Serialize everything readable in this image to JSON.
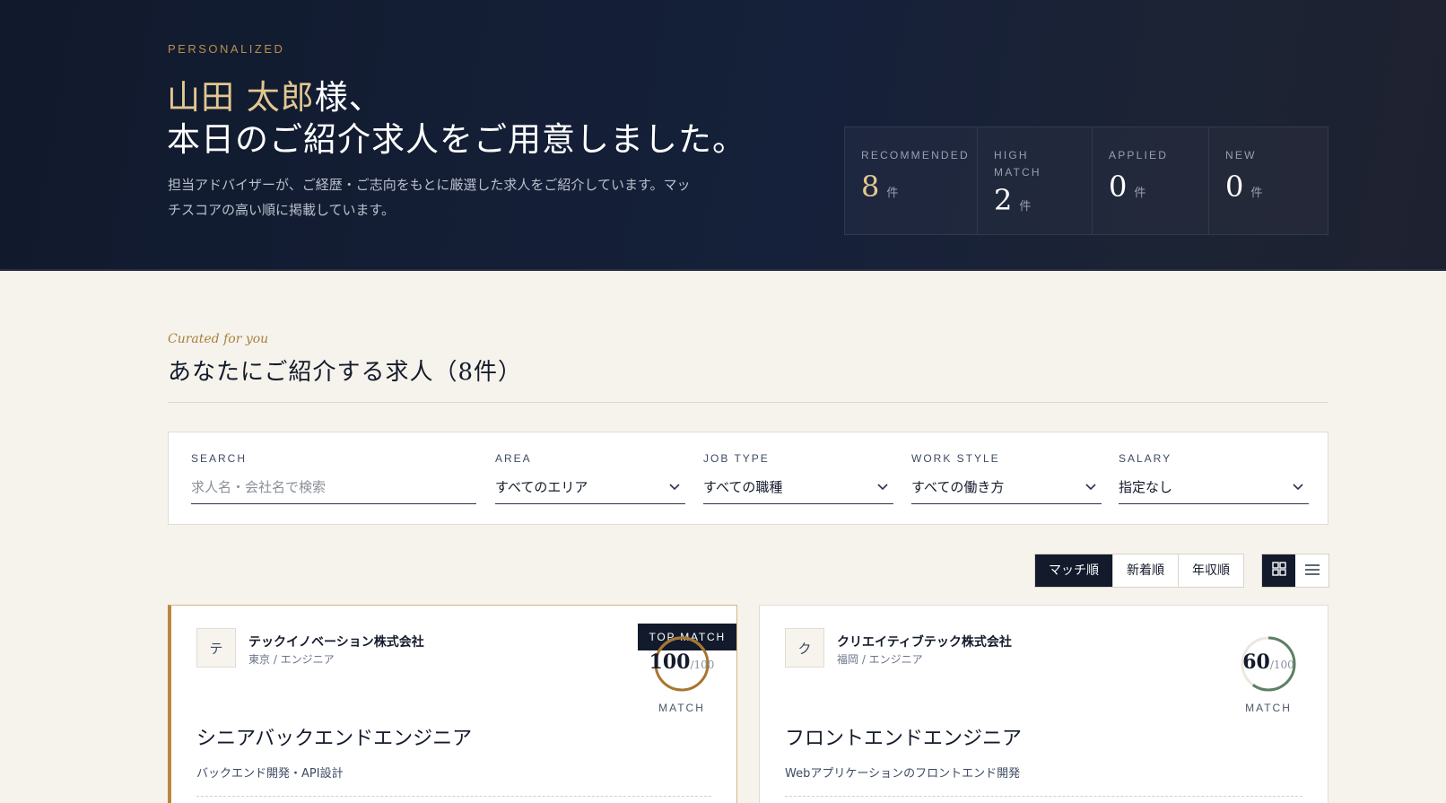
{
  "hero": {
    "eyebrow": "PERSONALIZED",
    "title_name": "山田 太郎",
    "title_suffix": "様、",
    "title_line2": "本日のご紹介求人をご用意しました。",
    "subtitle": "担当アドバイザーが、ご経歴・ご志向をもとに厳選した求人をご紹介しています。マッチスコアの高い順に掲載しています。",
    "stats": [
      {
        "label_line1": "RECOMMENDED",
        "label_line2": "",
        "value": "8",
        "unit": "件"
      },
      {
        "label_line1": "HIGH",
        "label_line2": "MATCH",
        "value": "2",
        "unit": "件"
      },
      {
        "label_line1": "APPLIED",
        "label_line2": "",
        "value": "0",
        "unit": "件"
      },
      {
        "label_line1": "NEW",
        "label_line2": "",
        "value": "0",
        "unit": "件"
      }
    ]
  },
  "section": {
    "eyebrow": "Curated for you",
    "title": "あなたにご紹介する求人（8件）"
  },
  "filters": {
    "search": {
      "label": "SEARCH",
      "placeholder": "求人名・会社名で検索"
    },
    "area": {
      "label": "AREA",
      "value": "すべてのエリア"
    },
    "job_type": {
      "label": "JOB TYPE",
      "value": "すべての職種"
    },
    "work_style": {
      "label": "WORK STYLE",
      "value": "すべての働き方"
    },
    "salary": {
      "label": "SALARY",
      "value": "指定なし"
    }
  },
  "sort": {
    "options": [
      "マッチ順",
      "新着順",
      "年収順"
    ],
    "active": "マッチ順"
  },
  "view": {
    "active": "grid"
  },
  "jobs": [
    {
      "logo_initial": "テ",
      "company": "テックイノベーション株式会社",
      "meta": "東京 / エンジニア",
      "badge": "TOP MATCH",
      "score": "100",
      "score_max": "/100",
      "score_label": "MATCH",
      "score_fraction": 1.0,
      "score_color": "#a8752f",
      "title": "シニアバックエンドエンジニア",
      "description": "バックエンド開発・API設計"
    },
    {
      "logo_initial": "ク",
      "company": "クリエイティブテック株式会社",
      "meta": "福岡 / エンジニア",
      "badge": "",
      "score": "60",
      "score_max": "/100",
      "score_label": "MATCH",
      "score_fraction": 0.6,
      "score_color": "#5d7f63",
      "title": "フロントエンドエンジニア",
      "description": "Webアプリケーションのフロントエンド開発"
    }
  ]
}
